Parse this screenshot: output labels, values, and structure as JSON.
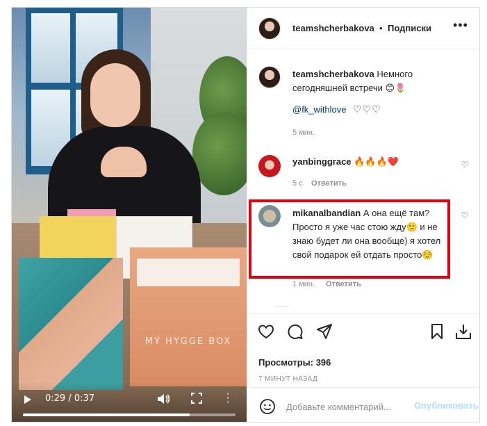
{
  "video": {
    "brand_text": "MY HYGGE BOX",
    "time": "0:29 / 0:37",
    "progress": 0.784
  },
  "header": {
    "username": "teamshcherbakova",
    "separator": "•",
    "follow_label": "Подписки"
  },
  "caption": {
    "username": "teamshcherbakova",
    "text": "Немного сегодняшней встречи 😊🌷",
    "mention": "@fk_withlove",
    "hearts": "♡♡♡",
    "time": "5 мин."
  },
  "comments": [
    {
      "username": "yanbinggrace",
      "text": "🔥🔥🔥❤️",
      "time": "5 с",
      "reply_label": "Ответить"
    },
    {
      "username": "mikanalbandian",
      "text": "А она ещё там? Просто я уже час стою жду🙁 и не знаю будет ли она вообще) я хотел свой подарок ей отдать просто☺️",
      "time": "1 мин.",
      "reply_label": "Ответить"
    }
  ],
  "stats": {
    "views": "Просмотры: 396",
    "posted": "7 МИНУТ НАЗАД"
  },
  "add_comment": {
    "placeholder": "Добавьте комментарий...",
    "publish_label": "Опубликовать"
  },
  "colors": {
    "highlight": "#e4000f",
    "link": "#00376b",
    "publish_disabled": "#b2dffc"
  }
}
